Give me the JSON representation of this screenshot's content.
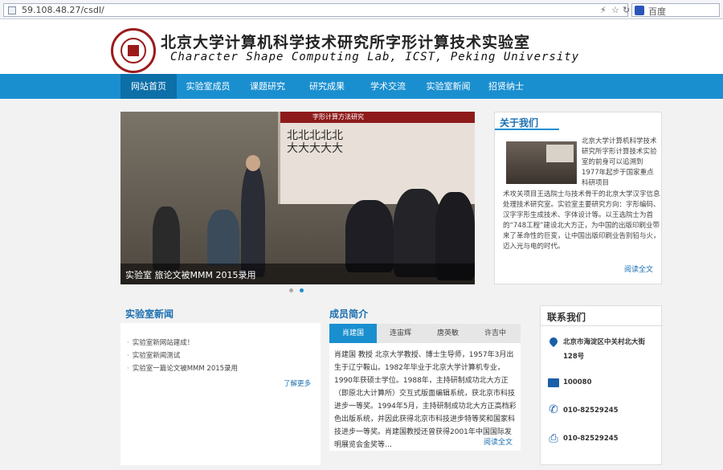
{
  "browser": {
    "url": "59.108.48.27/csdl/",
    "search_text": "百度"
  },
  "header": {
    "title_cn": "北京大学计算机科学技术研究所字形计算技术实验室",
    "title_en": "Character Shape Computing Lab, ICST, Peking University"
  },
  "nav": {
    "items": [
      {
        "label": "网站首页"
      },
      {
        "label": "实验室成员"
      },
      {
        "label": "课题研究"
      },
      {
        "label": "研究成果"
      },
      {
        "label": "学术交流"
      },
      {
        "label": "实验室新闻"
      },
      {
        "label": "招贤纳士"
      }
    ]
  },
  "slider": {
    "screen_title": "字形计算方法研究",
    "screen_chars": "北北北北北\n大大大大大",
    "caption": "实验室   旅论文被MMM 2015录用"
  },
  "about": {
    "title": "关于我们",
    "text_a": "北京大学计算机科学技术研究所字形计算技术实验室的前身可以追溯到1977年起步于国家重点科研项目",
    "text_b": "术攻关项目王选院士与技术骨干的北京大学汉字信息处理技术研究室。实验室主要研究方向：字形编码、汉字字形生成技术、字体设计等。以王选院士为首的“748工程”建设北大方正，为中国的出版印刷业带来了革命性的巨变，让中国出版印刷业告别铅与火，迈入光与电的时代。",
    "more": "阅读全文"
  },
  "news": {
    "title": "实验室新闻",
    "items": [
      "实验室新网站建成！",
      "实验室新闻测试",
      "实验室一篇论文被MMM 2015录用"
    ],
    "more": "了解更多"
  },
  "members": {
    "title": "成员简介",
    "tabs": [
      "肖建国",
      "连宙辉",
      "唐英敏",
      "许吉中"
    ],
    "body": "肖建国 教授 北京大学教授、博士生导师，1957年3月出生于辽宁鞍山。1982年毕业于北京大学计算机专业，1990年获硕士学位。1988年，主持研制成功北大方正（即原北大计算所）交互式版面编辑系统，获北京市科技进步一等奖。1994年5月，主持研制成功北大方正高档彩色出版系统，并因此获得北京市科技进步特等奖和国家科技进步一等奖。肖建国教授还曾获得2001年中国国际发明展览会金奖等…",
    "more": "阅读全文"
  },
  "contact": {
    "title": "联系我们",
    "address": "北京市海淀区中关村北大街128号",
    "postcode": "100080",
    "phone": "010-82529245",
    "fax": "010-82529245"
  }
}
